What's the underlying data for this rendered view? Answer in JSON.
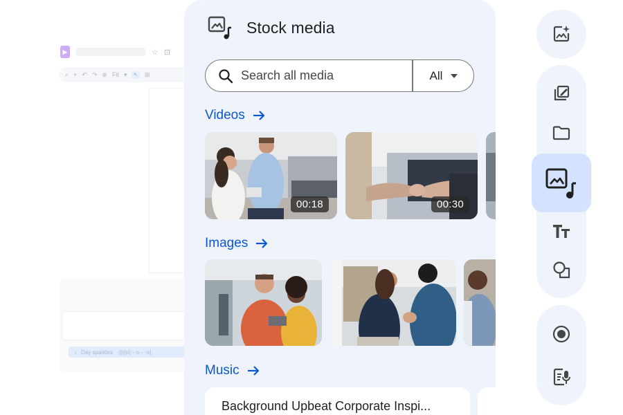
{
  "background_editor": {
    "toolbar": {
      "zoom_label": "Fit"
    },
    "audio_clip_label": "Day sparkles"
  },
  "panel": {
    "title": "Stock media",
    "search": {
      "placeholder": "Search all media",
      "filter_value": "All"
    },
    "sections": {
      "videos": {
        "label": "Videos",
        "items": [
          {
            "duration": "00:18"
          },
          {
            "duration": "00:30"
          }
        ]
      },
      "images": {
        "label": "Images"
      },
      "music": {
        "label": "Music",
        "items": [
          {
            "title": "Background Upbeat Corporate Inspi..."
          }
        ]
      }
    }
  },
  "rail": {
    "tools": [
      {
        "icon": "image-sparkle-icon"
      },
      {
        "icon": "edit-frame-icon"
      },
      {
        "icon": "folder-icon"
      },
      {
        "icon": "stock-media-icon",
        "active": true
      },
      {
        "icon": "text-icon"
      },
      {
        "icon": "shapes-icon"
      },
      {
        "icon": "record-icon"
      },
      {
        "icon": "script-voice-icon"
      }
    ]
  },
  "colors": {
    "accent": "#0b57d0",
    "panel_bg": "#eff3fb",
    "active_bg": "#d3e3fd",
    "icon": "#444746"
  }
}
